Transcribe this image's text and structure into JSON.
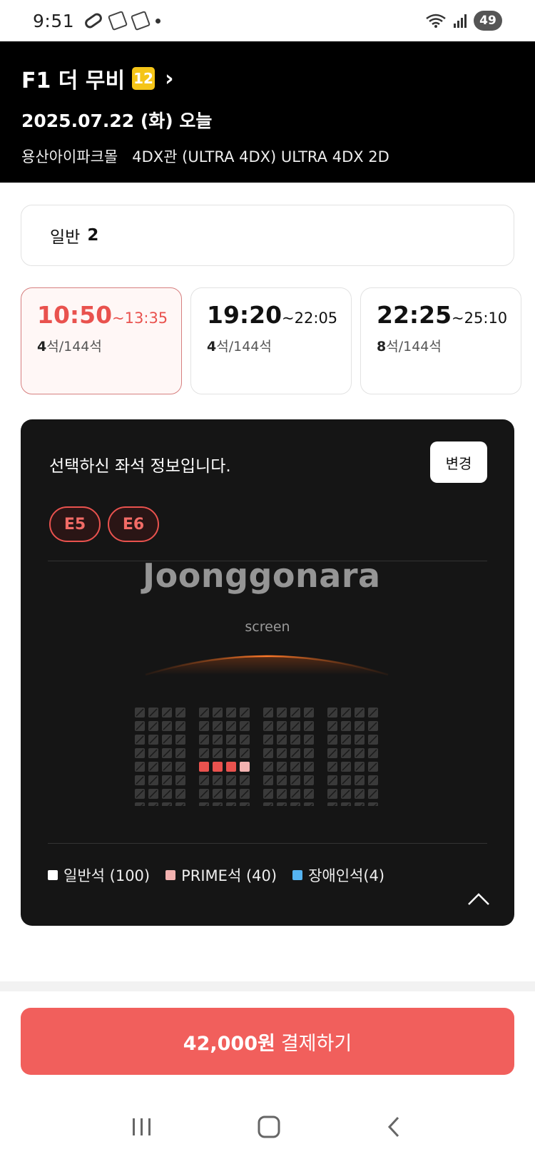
{
  "status_bar": {
    "time": "9:51",
    "battery": "49",
    "icons": [
      "pill-icon",
      "notification-icon",
      "notification-icon",
      "dot-icon",
      "wifi-icon",
      "signal-icon"
    ]
  },
  "movie": {
    "title": "F1 더 무비",
    "age_rating": "12",
    "date": "2025.07.22 (화) 오늘",
    "theater": "용산아이파크몰",
    "hall": "4DX관 (ULTRA 4DX) ULTRA 4DX 2D"
  },
  "audience": {
    "label": "일반",
    "count": "2"
  },
  "showtimes": [
    {
      "start": "10:50",
      "end": "~13:35",
      "remaining": "4",
      "total_text": "석/144석",
      "selected": true
    },
    {
      "start": "19:20",
      "end": "~22:05",
      "remaining": "4",
      "total_text": "석/144석",
      "selected": false
    },
    {
      "start": "22:25",
      "end": "~25:10",
      "remaining": "8",
      "total_text": "석/144석",
      "selected": false
    }
  ],
  "seat_panel": {
    "title": "선택하신 좌석 정보입니다.",
    "change_label": "변경",
    "selected_seats": [
      "E5",
      "E6"
    ],
    "screen_label": "screen",
    "legend": [
      {
        "label": "일반석 (100)",
        "color": "#ffffff"
      },
      {
        "label": "PRIME석 (40)",
        "color": "#f3b2b0"
      },
      {
        "label": "장애인석(4)",
        "color": "#55b4f2"
      }
    ],
    "colors": {
      "occupied": "#3a3a3a",
      "selected": "#e9524e",
      "prime_selected": "#f3b2b0",
      "accessible": "#55b4f2"
    }
  },
  "watermark": "Joonggonara",
  "payment": {
    "price": "42,000원",
    "label": "결제하기",
    "color": "#f15f5c"
  },
  "nav": {
    "icons": [
      "recent-apps-icon",
      "home-icon",
      "back-icon"
    ]
  }
}
